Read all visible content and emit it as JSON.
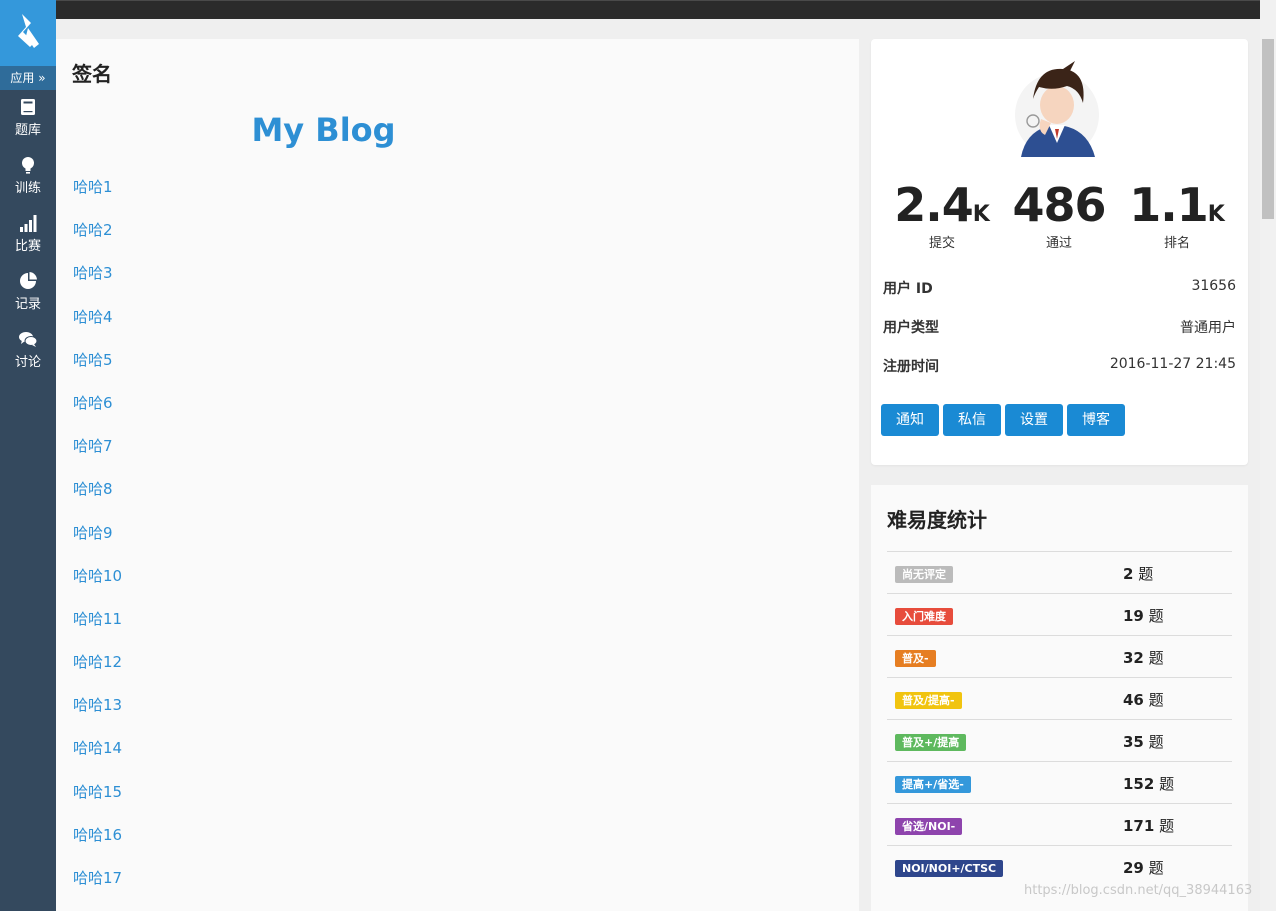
{
  "sidebar": {
    "apps_label": "应用 »",
    "items": [
      {
        "label": "题库",
        "icon": "book-icon"
      },
      {
        "label": "训练",
        "icon": "lightbulb-icon"
      },
      {
        "label": "比赛",
        "icon": "signal-bars-icon"
      },
      {
        "label": "记录",
        "icon": "pie-chart-icon"
      },
      {
        "label": "讨论",
        "icon": "chat-bubbles-icon"
      }
    ]
  },
  "signature": {
    "title": "签名",
    "blog_heading": "My Blog",
    "links": [
      "哈哈1",
      "哈哈2",
      "哈哈3",
      "哈哈4",
      "哈哈5",
      "哈哈6",
      "哈哈7",
      "哈哈8",
      "哈哈9",
      "哈哈10",
      "哈哈11",
      "哈哈12",
      "哈哈13",
      "哈哈14",
      "哈哈15",
      "哈哈16",
      "哈哈17"
    ]
  },
  "profile": {
    "stats": [
      {
        "value": "2.4",
        "unit": "K",
        "label": "提交"
      },
      {
        "value": "486",
        "unit": "",
        "label": "通过"
      },
      {
        "value": "1.1",
        "unit": "K",
        "label": "排名"
      }
    ],
    "info": [
      {
        "key": "用户 ID",
        "value": "31656"
      },
      {
        "key": "用户类型",
        "value": "普通用户"
      },
      {
        "key": "注册时间",
        "value": "2016-11-27 21:45"
      }
    ],
    "buttons": [
      "通知",
      "私信",
      "设置",
      "博客"
    ]
  },
  "difficulty": {
    "title": "难易度统计",
    "unit": "题",
    "rows": [
      {
        "tag": "尚无评定",
        "count": "2",
        "color": "#bbbbbb"
      },
      {
        "tag": "入门难度",
        "count": "19",
        "color": "#e74c3c"
      },
      {
        "tag": "普及-",
        "count": "32",
        "color": "#e67e22"
      },
      {
        "tag": "普及/提高-",
        "count": "46",
        "color": "#f1c40f"
      },
      {
        "tag": "普及+/提高",
        "count": "35",
        "color": "#5eb95e"
      },
      {
        "tag": "提高+/省选-",
        "count": "152",
        "color": "#3498db"
      },
      {
        "tag": "省选/NOI-",
        "count": "171",
        "color": "#8e44ad"
      },
      {
        "tag": "NOI/NOI+/CTSC",
        "count": "29",
        "color": "#2e468c"
      }
    ]
  },
  "colors": {
    "sidebar": "#34495e",
    "logo": "#3498db",
    "accent": "#1a8ad4",
    "link": "#2d8fd4"
  },
  "watermark": "https://blog.csdn.net/qq_38944163"
}
